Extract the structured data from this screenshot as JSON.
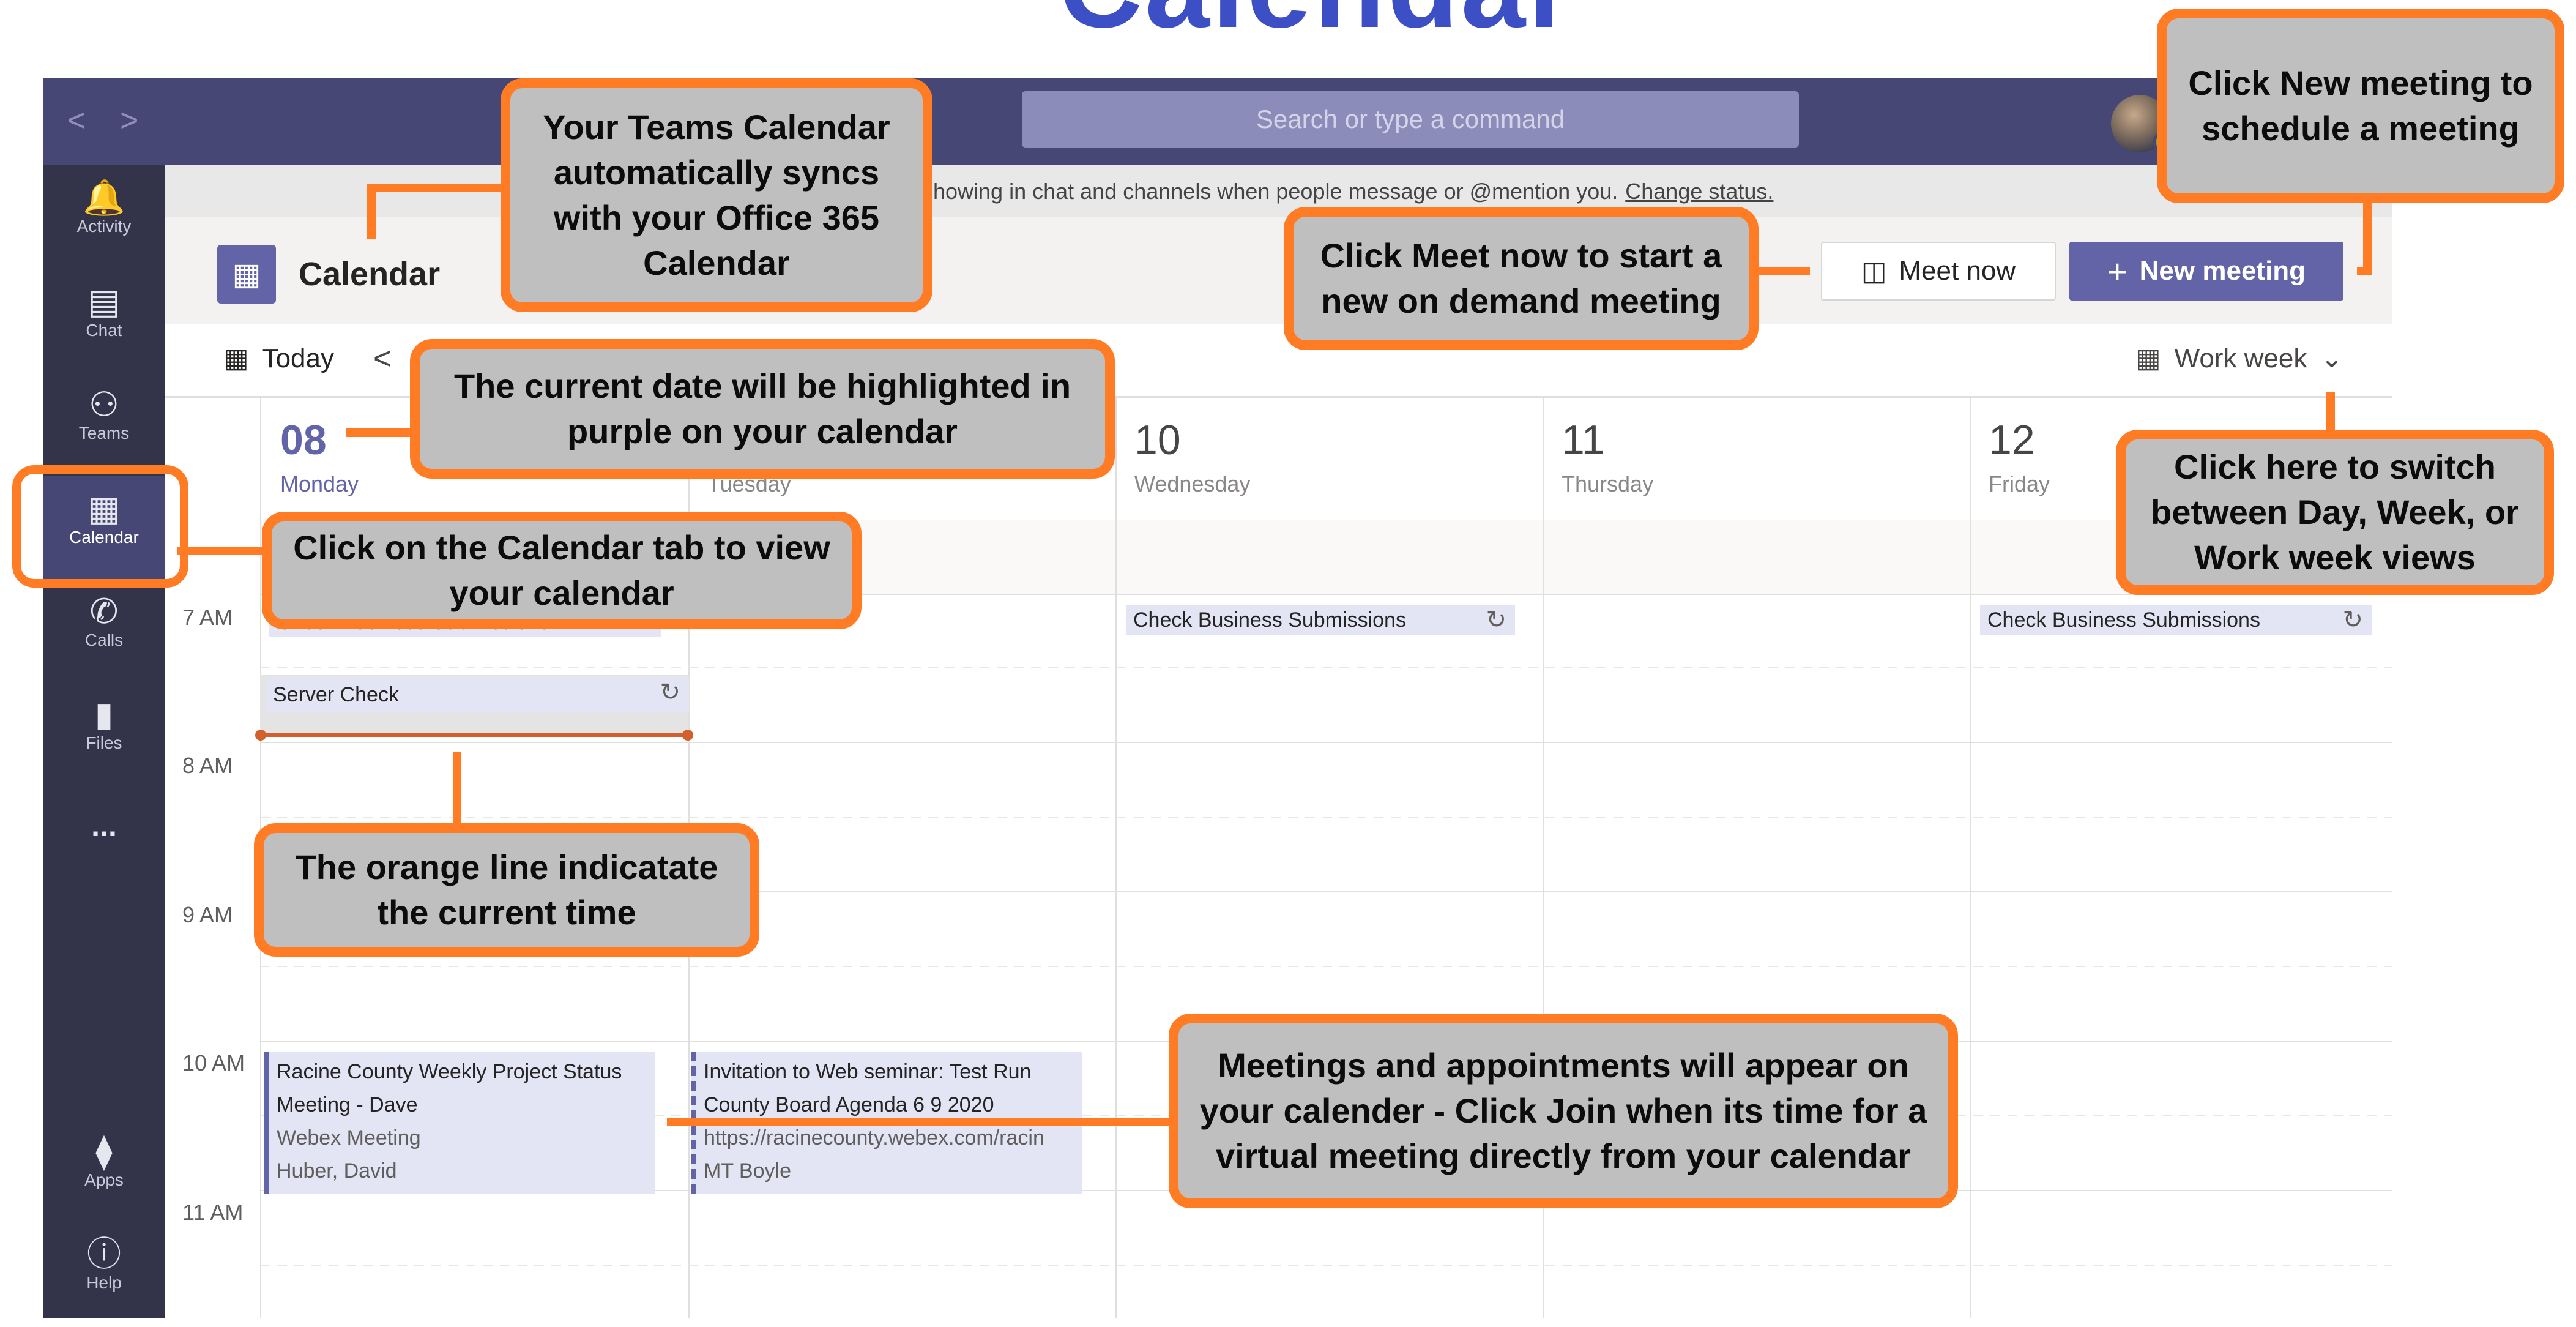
{
  "banner": {
    "title": "Calendar"
  },
  "titlebar": {
    "back_glyph": "<",
    "forward_glyph": ">",
    "search_placeholder": "Search or type a command"
  },
  "rail": {
    "items": [
      {
        "label": "Activity",
        "icon": "bell-icon"
      },
      {
        "label": "Chat",
        "icon": "chat-icon"
      },
      {
        "label": "Teams",
        "icon": "teams-icon"
      },
      {
        "label": "Calendar",
        "icon": "calendar-icon",
        "active": true
      },
      {
        "label": "Calls",
        "icon": "phone-icon"
      },
      {
        "label": "Files",
        "icon": "file-icon"
      },
      {
        "label": "...",
        "icon": "more-icon"
      },
      {
        "label": "Apps",
        "icon": "apps-icon"
      },
      {
        "label": "Help",
        "icon": "help-icon"
      }
    ]
  },
  "notice": {
    "text": "howing in chat and channels when people message or @mention you.",
    "link": "Change status."
  },
  "header": {
    "title": "Calendar",
    "meet_now": "Meet now",
    "new_meeting": "New meeting"
  },
  "toolbar": {
    "today": "Today",
    "view": "Work week"
  },
  "days": [
    {
      "num": "08",
      "name": "Monday",
      "today": true
    },
    {
      "num": "",
      "name": "Tuesday"
    },
    {
      "num": "10",
      "name": "Wednesday"
    },
    {
      "num": "11",
      "name": "Thursday"
    },
    {
      "num": "12",
      "name": "Friday"
    }
  ],
  "times": [
    "7 AM",
    "8 AM",
    "9 AM",
    "10 AM",
    "11 AM"
  ],
  "events": {
    "check_mon": "Check Business Submissions",
    "check_wed": "Check Business Submissions",
    "check_fri": "Check Business Submissions",
    "server_check": "Server Check",
    "racine": {
      "title": "Racine County Weekly Project Status Meeting - Dave",
      "location": "Webex Meeting",
      "organizer": "Huber, David"
    },
    "invitation": {
      "title": "Invitation to Web seminar: Test Run County Board Agenda 6 9 2020",
      "location": "https://racinecounty.webex.com/racin",
      "organizer": "MT Boyle"
    }
  },
  "callouts": {
    "sync": "Your Teams Calendar automatically syncs with your Office 365 Calendar",
    "new_meeting": "Click New meeting to schedule a meeting",
    "meet_now": "Click Meet now to start a new on demand meeting",
    "current_date": "The current date will be highlighted in purple on your calendar",
    "switch_view": "Click here to switch between Day, Week, or Work week views",
    "calendar_tab": "Click on the Calendar tab to view your calendar",
    "orange_line": "The orange line indicatate the current time",
    "meetings": "Meetings and appointments will appear on your calender - Click Join when its time for a virtual meeting directly from your calendar"
  },
  "colors": {
    "brand_purple": "#6264a7",
    "rail_dark": "#33344a",
    "titlebar": "#464775",
    "callout_border": "#ff7c24",
    "callout_fill": "#bfbfbf",
    "now_line": "#d1602c"
  }
}
